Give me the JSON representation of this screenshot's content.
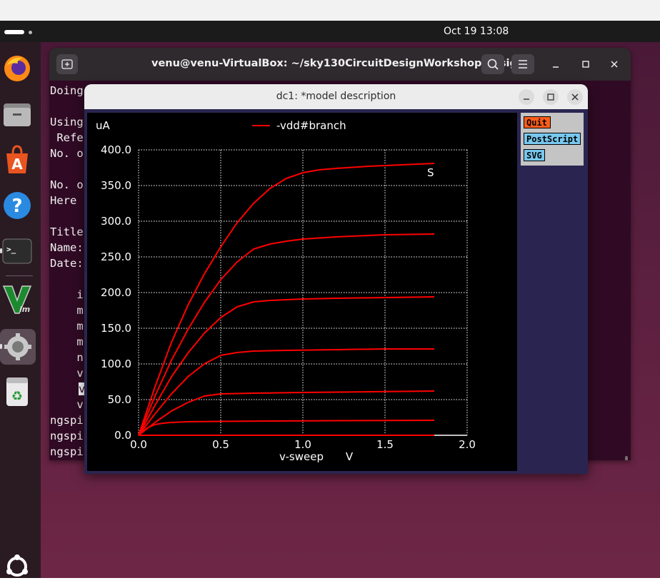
{
  "topbar": {
    "clock": "Oct 19  13:08"
  },
  "dock": {
    "items": [
      {
        "name": "firefox"
      },
      {
        "name": "files"
      },
      {
        "name": "app-center"
      },
      {
        "name": "help"
      },
      {
        "name": "terminal",
        "glyph": ">_"
      },
      {
        "name": "vim"
      },
      {
        "name": "settings"
      },
      {
        "name": "trash"
      },
      {
        "name": "ubuntu"
      }
    ]
  },
  "terminal": {
    "title": "venu@venu-VirtualBox: ~/sky130CircuitDesignWorkshop/design",
    "lines": [
      "Doing",
      "",
      "Using",
      " Refe",
      "No. o",
      "",
      "No. o",
      "Here",
      "",
      "Title",
      "Name:",
      "Date:",
      "",
      "    i",
      "    m",
      "    m",
      "    m",
      "    n",
      "    v",
      "    v",
      "    v",
      "ngspi",
      "ngspi",
      "ngspi"
    ]
  },
  "plot_window": {
    "title": "dc1: *model description",
    "buttons": {
      "quit": "Quit",
      "postscript": "PostScript",
      "svg": "SVG"
    }
  },
  "chart_data": {
    "type": "line",
    "ylabel": "uA",
    "xlabel": "v-sweep",
    "xunit": "V",
    "legend": "-vdd#branch",
    "legend_position": "top",
    "annotation": "S",
    "xlim": [
      0.0,
      2.0
    ],
    "ylim": [
      0.0,
      400.0
    ],
    "xticks": [
      "0.0",
      "0.5",
      "1.0",
      "1.5",
      "2.0"
    ],
    "yticks": [
      "0.0",
      "50.0",
      "100.0",
      "150.0",
      "200.0",
      "250.0",
      "300.0",
      "350.0",
      "400.0"
    ],
    "grid": true,
    "colors": {
      "line": "#ff0000",
      "grid": "#ffffff",
      "axis_text": "#ffffff",
      "background": "#000000"
    },
    "series": [
      {
        "x": [
          0,
          0.1,
          0.2,
          0.3,
          0.4,
          0.5,
          0.6,
          0.7,
          0.8,
          0.9,
          1.0,
          1.2,
          1.4,
          1.6,
          1.8
        ],
        "y": [
          0,
          0,
          0,
          0,
          0,
          0,
          0,
          0,
          0,
          0,
          0,
          0,
          0,
          0,
          0
        ]
      },
      {
        "x": [
          0,
          0.05,
          0.1,
          0.15,
          0.2,
          0.3,
          0.5,
          0.8,
          1.2,
          1.8
        ],
        "y": [
          0,
          10,
          15,
          17,
          18,
          19,
          19.5,
          20,
          20.5,
          21
        ]
      },
      {
        "x": [
          0,
          0.1,
          0.2,
          0.3,
          0.4,
          0.5,
          0.7,
          1.0,
          1.4,
          1.8
        ],
        "y": [
          0,
          18,
          34,
          46,
          55,
          58,
          59,
          60,
          61,
          62
        ]
      },
      {
        "x": [
          0,
          0.1,
          0.2,
          0.3,
          0.4,
          0.5,
          0.6,
          0.7,
          0.9,
          1.2,
          1.5,
          1.8
        ],
        "y": [
          0,
          30,
          58,
          82,
          100,
          112,
          116,
          118,
          119,
          120,
          121,
          121
        ]
      },
      {
        "x": [
          0,
          0.1,
          0.2,
          0.3,
          0.4,
          0.5,
          0.6,
          0.7,
          0.8,
          0.9,
          1.0,
          1.2,
          1.5,
          1.8
        ],
        "y": [
          0,
          42,
          82,
          115,
          143,
          165,
          180,
          187,
          189,
          190,
          191,
          192,
          193,
          194
        ]
      },
      {
        "x": [
          0,
          0.1,
          0.2,
          0.3,
          0.4,
          0.5,
          0.6,
          0.7,
          0.8,
          0.9,
          1.0,
          1.2,
          1.5,
          1.8
        ],
        "y": [
          0,
          55,
          105,
          148,
          186,
          218,
          243,
          261,
          268,
          272,
          275,
          278,
          281,
          282
        ]
      },
      {
        "x": [
          0,
          0.1,
          0.2,
          0.3,
          0.4,
          0.5,
          0.6,
          0.7,
          0.8,
          0.9,
          1.0,
          1.1,
          1.2,
          1.4,
          1.6,
          1.8
        ],
        "y": [
          0,
          68,
          130,
          182,
          226,
          264,
          298,
          325,
          346,
          360,
          368,
          372,
          374,
          377,
          379,
          381
        ]
      }
    ]
  }
}
